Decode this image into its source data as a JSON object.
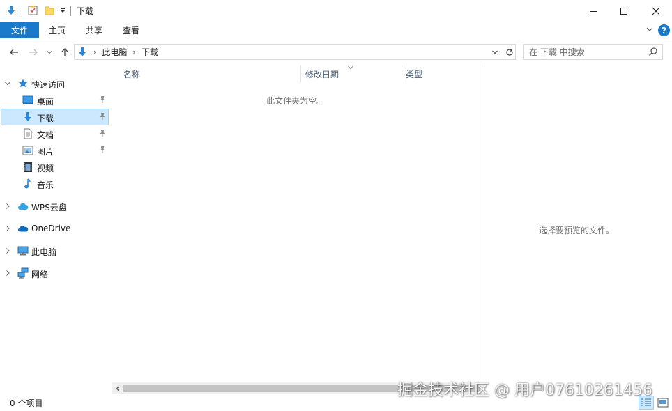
{
  "window": {
    "title": "下载"
  },
  "ribbon": {
    "tabs": [
      "文件",
      "主页",
      "共享",
      "查看"
    ],
    "help": "?"
  },
  "address": {
    "segments": [
      "此电脑",
      "下载"
    ]
  },
  "search": {
    "placeholder": "在 下载 中搜索"
  },
  "nav": {
    "quick_access": "快速访问",
    "quick_items": [
      "桌面",
      "下载",
      "文档",
      "图片",
      "视频",
      "音乐"
    ],
    "roots": [
      "WPS云盘",
      "OneDrive",
      "此电脑",
      "网络"
    ]
  },
  "columns": [
    "名称",
    "修改日期",
    "类型"
  ],
  "content": {
    "empty_message": "此文件夹为空。"
  },
  "preview": {
    "message": "选择要预览的文件。"
  },
  "status": {
    "count": "0 个项目"
  },
  "watermark": "掘金技术社区 @ 用户07610261456",
  "colors": {
    "accent": "#1979ca",
    "selection": "#cce8ff",
    "selection_border": "#99d1ff"
  }
}
